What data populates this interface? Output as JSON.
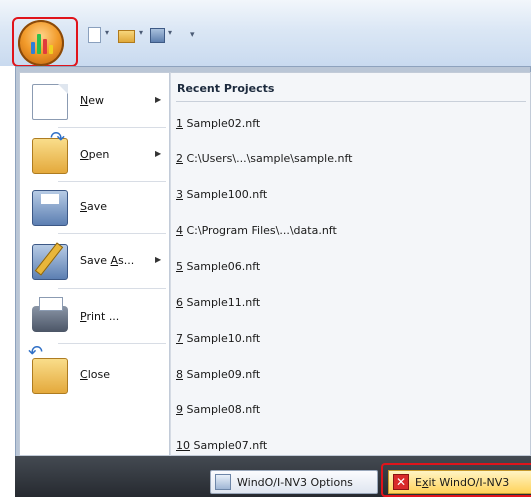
{
  "qat": {
    "icons": [
      "new-document-icon",
      "open-folder-icon",
      "save-icon",
      "customize-qat-icon"
    ]
  },
  "menu": {
    "items": [
      {
        "label": "New",
        "mnemonic": "N",
        "rest": "ew",
        "has_submenu": true,
        "icon": "new-document-icon"
      },
      {
        "label": "Open",
        "mnemonic": "O",
        "rest": "pen",
        "has_submenu": true,
        "icon": "open-folder-icon"
      },
      {
        "label": "Save",
        "mnemonic": "S",
        "rest": "ave",
        "has_submenu": false,
        "icon": "save-icon"
      },
      {
        "label": "Save As...",
        "prefix": "Save ",
        "mnemonic": "A",
        "rest": "s...",
        "has_submenu": true,
        "icon": "save-as-icon"
      },
      {
        "label": "Print ...",
        "mnemonic": "P",
        "rest": "rint ...",
        "has_submenu": false,
        "icon": "print-icon"
      },
      {
        "label": "Close",
        "mnemonic": "C",
        "rest": "lose",
        "has_submenu": false,
        "icon": "close-icon"
      }
    ]
  },
  "recent": {
    "title": "Recent Projects",
    "items": [
      {
        "num": "1",
        "name": "Sample02.nft"
      },
      {
        "num": "2",
        "name": "C:\\Users\\...\\sample\\sample.nft"
      },
      {
        "num": "3",
        "name": "Sample100.nft"
      },
      {
        "num": "4",
        "name": "C:\\Program Files\\...\\data.nft"
      },
      {
        "num": "5",
        "name": "Sample06.nft"
      },
      {
        "num": "6",
        "name": "Sample11.nft"
      },
      {
        "num": "7",
        "name": "Sample10.nft"
      },
      {
        "num": "8",
        "name": "Sample09.nft"
      },
      {
        "num": "9",
        "name": "Sample08.nft"
      },
      {
        "num": "10",
        "name": "Sample07.nft"
      }
    ]
  },
  "footer": {
    "options_label": "WindO/I-NV3 Options",
    "exit_mnemonic": "x",
    "exit_prefix": "E",
    "exit_rest": "it WindO/I-NV3"
  },
  "colors": {
    "highlight_frame": "#e0141b",
    "exit_button": "#ffd35b"
  }
}
